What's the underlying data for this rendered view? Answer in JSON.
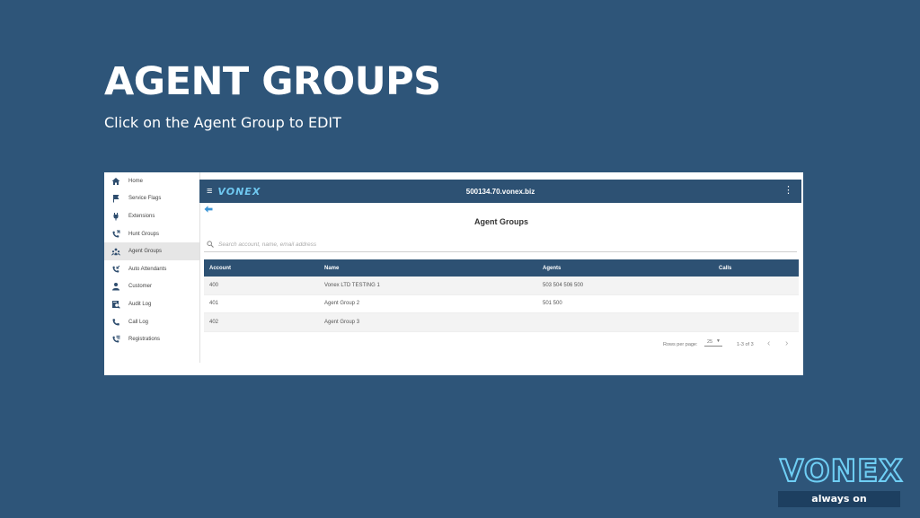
{
  "slide": {
    "title": "AGENT GROUPS",
    "subtitle": "Click on the Agent Group to EDIT"
  },
  "sidebar": {
    "items": [
      {
        "label": "Home",
        "icon": "home-icon"
      },
      {
        "label": "Service Flags",
        "icon": "flag-icon"
      },
      {
        "label": "Extensions",
        "icon": "plug-icon"
      },
      {
        "label": "Hunt Groups",
        "icon": "phone-forward-icon"
      },
      {
        "label": "Agent Groups",
        "icon": "agents-icon",
        "active": true
      },
      {
        "label": "Auto Attendants",
        "icon": "phone-callback-icon"
      },
      {
        "label": "Customer",
        "icon": "person-icon"
      },
      {
        "label": "Audit Log",
        "icon": "audit-icon"
      },
      {
        "label": "Call Log",
        "icon": "phone-icon"
      },
      {
        "label": "Registrations",
        "icon": "phone-list-icon"
      }
    ]
  },
  "topbar": {
    "logo": "VONEX",
    "host": "500134.70.vonex.biz",
    "menu_glyph": "≡",
    "more_glyph": "⋮"
  },
  "content": {
    "title": "Agent Groups",
    "search_placeholder": "Search account, name, email address"
  },
  "table": {
    "columns": [
      "Account",
      "Name",
      "Agents",
      "Calls"
    ],
    "rows": [
      [
        "400",
        "Vonex LTD TESTING 1",
        "503 504 506 500",
        ""
      ],
      [
        "401",
        "Agent Group 2",
        "501 500",
        ""
      ],
      [
        "402",
        "Agent Group 3",
        "",
        ""
      ]
    ]
  },
  "pager": {
    "rows_per_page_label": "Rows per page:",
    "rows_per_page_value": "25",
    "range": "1-3 of 3",
    "prev": "‹",
    "next": "›"
  },
  "brand": {
    "name": "VONEX",
    "tagline": "always on"
  },
  "colors": {
    "background": "#2e5579",
    "header": "#2d5173",
    "accent": "#6fc8f0",
    "back_arrow": "#3b95d6"
  }
}
